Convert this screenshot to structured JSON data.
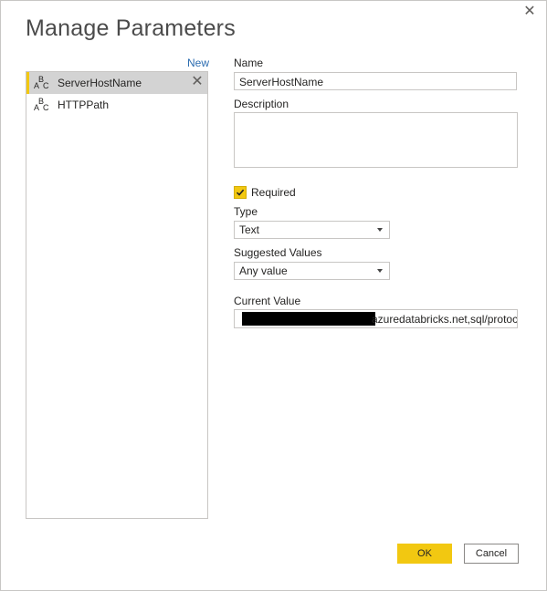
{
  "dialog": {
    "title": "Manage Parameters",
    "close_glyph": "✕"
  },
  "params": {
    "new_label": "New",
    "items": [
      {
        "label": "ServerHostName",
        "icon": "abc-text-type-icon",
        "selected": true
      },
      {
        "label": "HTTPPath",
        "icon": "abc-text-type-icon",
        "selected": false
      }
    ],
    "remove_glyph": "✕",
    "abc": {
      "a": "A",
      "b": "B",
      "c": "C"
    }
  },
  "form": {
    "name_label": "Name",
    "name_value": "ServerHostName",
    "description_label": "Description",
    "description_value": "",
    "required_label": "Required",
    "required_checked": true,
    "type_label": "Type",
    "type_value": "Text",
    "suggested_label": "Suggested Values",
    "suggested_value": "Any value",
    "current_value_label": "Current Value",
    "current_value_visible": "azuredatabricks.net,sql/protoc"
  },
  "buttons": {
    "ok": "OK",
    "cancel": "Cancel"
  },
  "colors": {
    "accent": "#f2c811",
    "link": "#2b6cb0",
    "selected_bg": "#d3d3d3"
  }
}
